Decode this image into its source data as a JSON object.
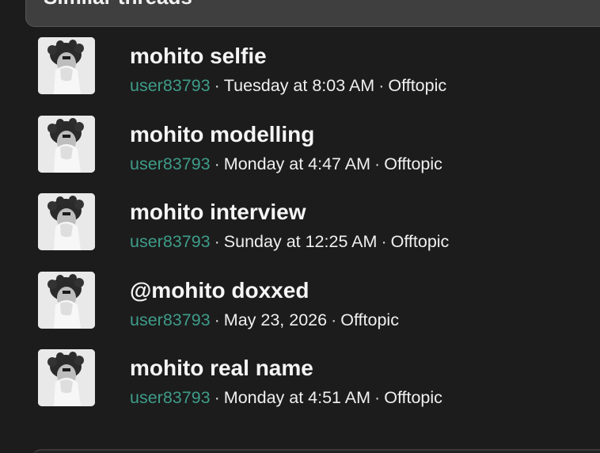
{
  "section": {
    "title": "Similar threads"
  },
  "threads": [
    {
      "title": "mohito selfie",
      "user": "user83793",
      "separator": "·",
      "date": "Tuesday at 8:03 AM",
      "forum": "Offtopic"
    },
    {
      "title": "mohito modelling",
      "user": "user83793",
      "separator": "·",
      "date": "Monday at 4:47 AM",
      "forum": "Offtopic"
    },
    {
      "title": "mohito interview",
      "user": "user83793",
      "separator": "·",
      "date": "Sunday at 12:25 AM",
      "forum": "Offtopic"
    },
    {
      "title": "@mohito doxxed",
      "user": "user83793",
      "separator": "·",
      "date": "May 23, 2026",
      "forum": "Offtopic"
    },
    {
      "title": "mohito real name",
      "user": "user83793",
      "separator": "·",
      "date": "Monday at 4:51 AM",
      "forum": "Offtopic"
    }
  ],
  "colors": {
    "background": "#1c1c1c",
    "header_background": "#3f3f3f",
    "username": "#3e9c89",
    "text": "#f5f5f5"
  },
  "icons": {
    "avatar": "user-avatar-photo-icon"
  }
}
